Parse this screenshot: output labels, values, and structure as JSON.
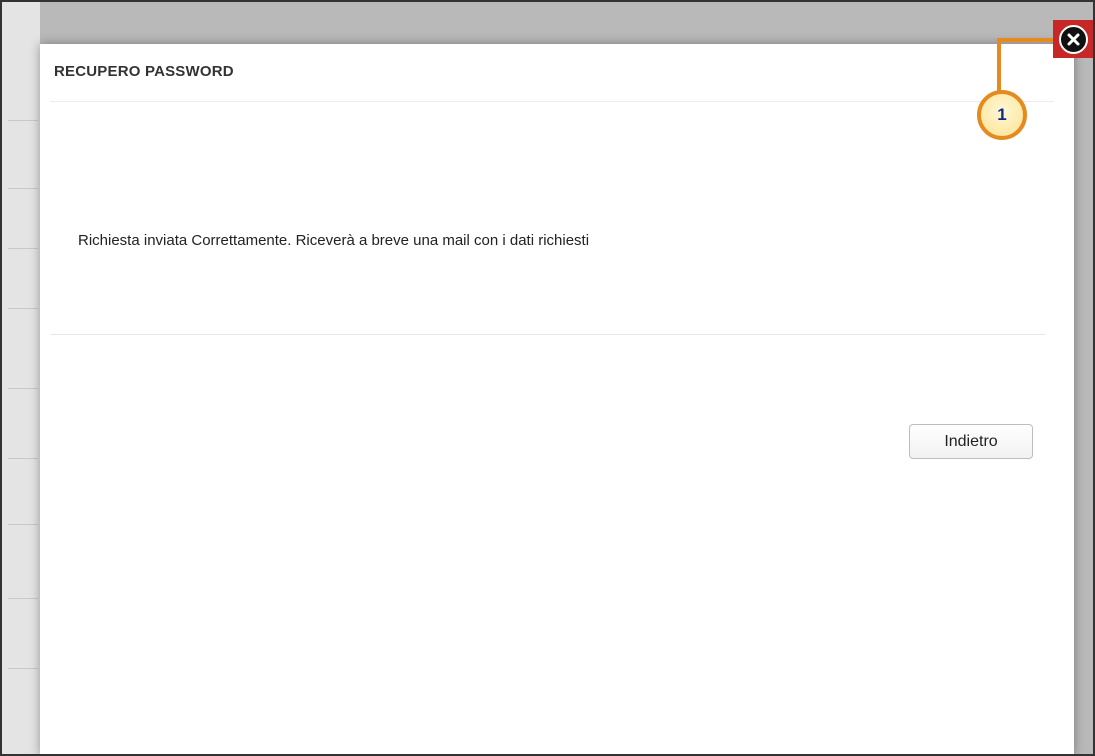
{
  "dialog": {
    "title": "RECUPERO PASSWORD",
    "message": "Richiesta inviata Correttamente. Riceverà a breve una mail con i dati richiesti",
    "back_button_label": "Indietro",
    "close_icon": "close-icon"
  },
  "annotation": {
    "callout_number": "1",
    "highlight_color": "#c62828",
    "callout_color": "#e58a1f"
  }
}
